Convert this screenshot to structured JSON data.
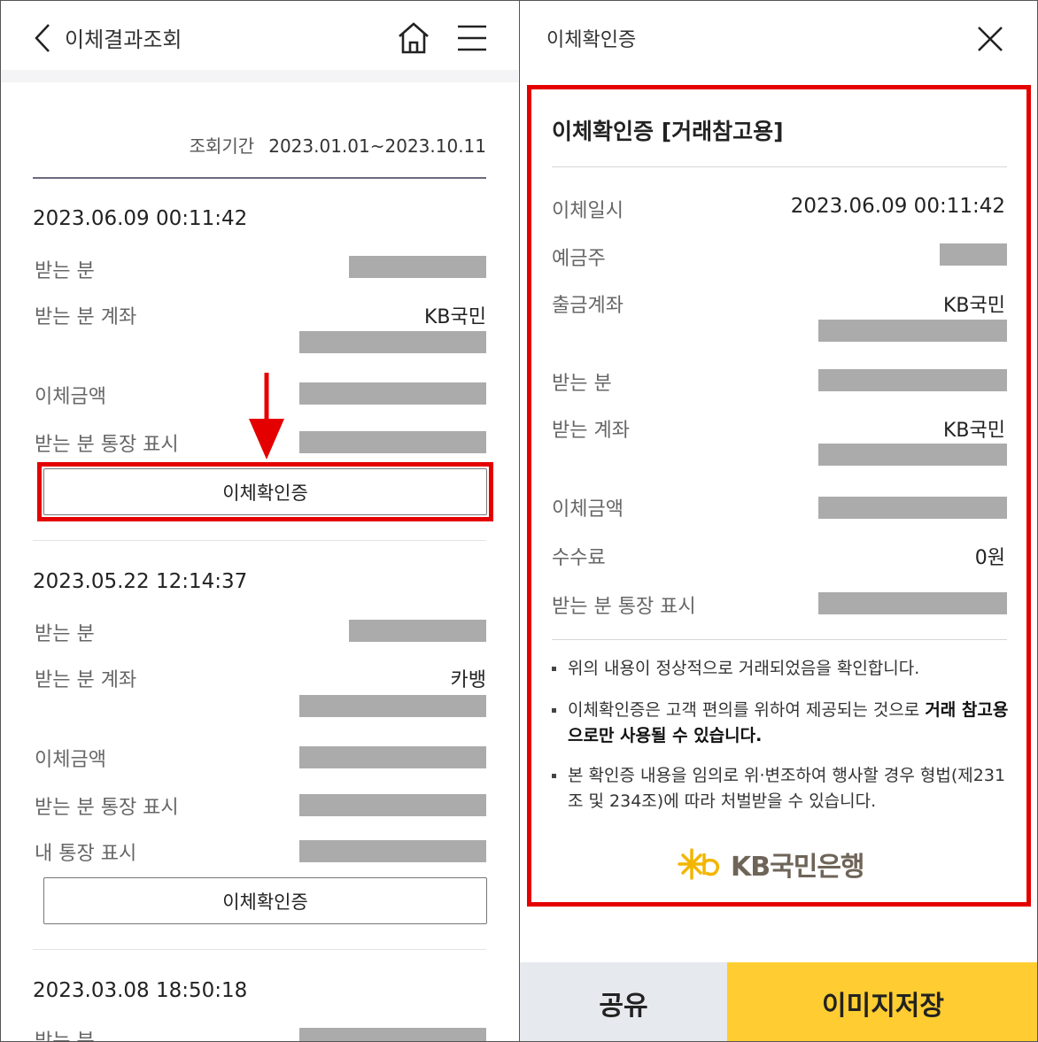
{
  "left": {
    "header": {
      "title": "이체결과조회",
      "back_icon": "chevron-left-icon",
      "home_icon": "home-icon",
      "menu_icon": "hamburger-menu-icon"
    },
    "period": {
      "label": "조회기간",
      "value": "2023.01.01~2023.10.11"
    },
    "records": [
      {
        "datetime": "2023.06.09 00:11:42",
        "recipient_label": "받는 분",
        "account_label": "받는 분 계좌",
        "account_bank": "KB국민",
        "amount_label": "이체금액",
        "passbook_label": "받는 분 통장 표시",
        "button_label": "이체확인증"
      },
      {
        "datetime": "2023.05.22 12:14:37",
        "recipient_label": "받는 분",
        "account_label": "받는 분 계좌",
        "account_bank": "카뱅",
        "amount_label": "이체금액",
        "passbook_label": "받는 분 통장 표시",
        "my_passbook_label": "내 통장 표시",
        "button_label": "이체확인증"
      },
      {
        "datetime": "2023.03.08 18:50:18",
        "recipient_label": "받는 분"
      }
    ],
    "highlight_color": "#e50000"
  },
  "right": {
    "header": {
      "title": "이체확인증",
      "close_icon": "close-icon"
    },
    "certificate": {
      "title": "이체확인증 [거래참고용]",
      "rows": {
        "datetime_label": "이체일시",
        "datetime_value": "2023.06.09 00:11:42",
        "holder_label": "예금주",
        "withdraw_label": "출금계좌",
        "withdraw_bank": "KB국민",
        "recipient_label": "받는 분",
        "recv_account_label": "받는 계좌",
        "recv_bank": "KB국민",
        "amount_label": "이체금액",
        "fee_label": "수수료",
        "fee_value": "0원",
        "passbook_label": "받는 분 통장 표시"
      },
      "notes": {
        "n1": "위의 내용이 정상적으로 거래되었음을 확인합니다.",
        "n2_normal": "이체확인증은 고객 편의를 위하여 제공되는 것으로 ",
        "n2_bold": "거래 참고용으로만 사용될 수 있습니다.",
        "n3": "본 확인증 내용을 임의로 위·변조하여 행사할 경우 형법(제231조 및 234조)에 따라 처벌받을 수 있습니다."
      },
      "logo": {
        "text": "KB국민은행",
        "icon": "kb-star-logo-icon"
      }
    },
    "buttons": {
      "share": "공유",
      "save_image": "이미지저장"
    },
    "colors": {
      "accent": "#ffcd31",
      "share_bg": "#e6e9ed",
      "highlight": "#e50000"
    }
  }
}
